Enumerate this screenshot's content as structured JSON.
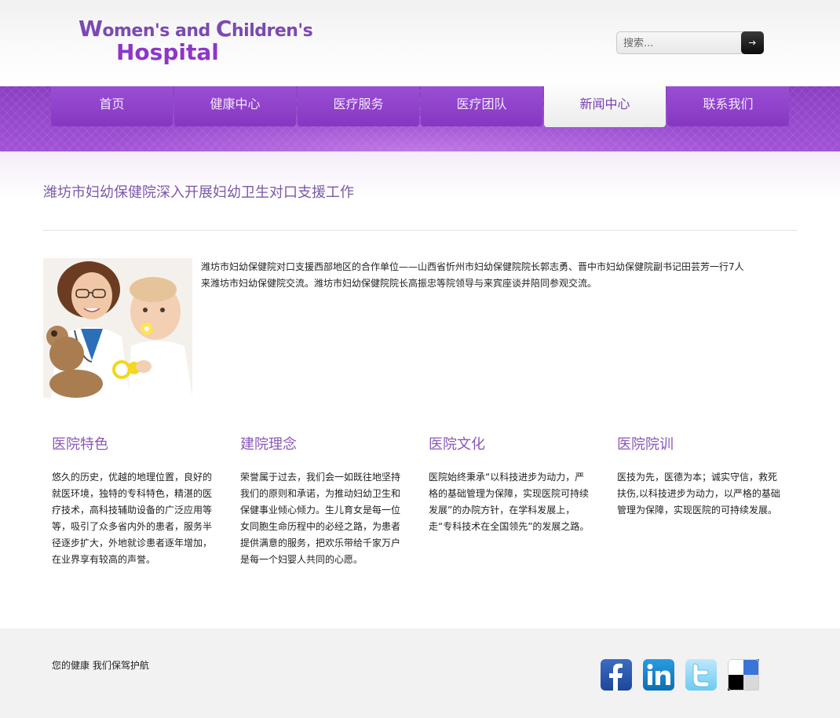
{
  "header": {
    "logo": {
      "line1_initial_w": "W",
      "line1_rest_a": "omen's and ",
      "line1_initial_c": "C",
      "line1_rest_b": "hildren's",
      "line2": "Hospital"
    },
    "search": {
      "placeholder": "搜索...",
      "button_icon": "arrow-right-icon"
    }
  },
  "nav": {
    "items": [
      {
        "label": "首页"
      },
      {
        "label": "健康中心"
      },
      {
        "label": "医疗服务"
      },
      {
        "label": "医疗团队"
      },
      {
        "label": "新闻中心",
        "active": true
      },
      {
        "label": "联系我们"
      }
    ]
  },
  "article": {
    "title": "潍坊市妇幼保健院深入开展妇幼卫生对口支援工作",
    "body_line1": "潍坊市妇幼保健院对口支援西部地区的合作单位——山西省忻州市妇幼保健院院长郭志勇、晋中市妇幼保健院副书记田芸芳一行7人",
    "body_line2": "来潍坊市妇幼保健院交流。潍坊市妇幼保健院院长高振忠等院领导与来宾座谈并陪同参观交流。"
  },
  "columns": [
    {
      "title": "医院特色",
      "text": "悠久的历史，优越的地理位置，良好的就医环境，独特的专科特色，精湛的医疗技术，高科技辅助设备的广泛应用等等，吸引了众多省内外的患者，服务半径逐步扩大，外地就诊患者逐年增加，在业界享有较高的声誉。"
    },
    {
      "title": "建院理念",
      "text": "荣誉属于过去，我们会一如既往地坚持我们的原则和承诺，为推动妇幼卫生和保健事业倾心倾力。生儿育女是每一位女同胞生命历程中的必经之路，为患者提供满意的服务，把欢乐带给千家万户是每一个妇婴人共同的心愿。"
    },
    {
      "title": "医院文化",
      "text": "医院始终秉承“以科技进步为动力，严格的基础管理为保障，实现医院可持续发展”的办院方针，在学科发展上，走“专科技术在全国领先”的发展之路。"
    },
    {
      "title": "医院院训",
      "text": "医技为先，医德为本；诚实守信，救死扶伤,以科技进步为动力，以严格的基础管理为保障，实现医院的可持续发展。"
    }
  ],
  "footer": {
    "slogan": "您的健康 我们保驾护航",
    "social": [
      "facebook-icon",
      "linkedin-icon",
      "twitter-icon",
      "delicious-icon"
    ]
  },
  "colors": {
    "brand_purple": "#8e36c8",
    "nav_purple": "#9a4fd3",
    "title_purple": "#7c58a8"
  }
}
